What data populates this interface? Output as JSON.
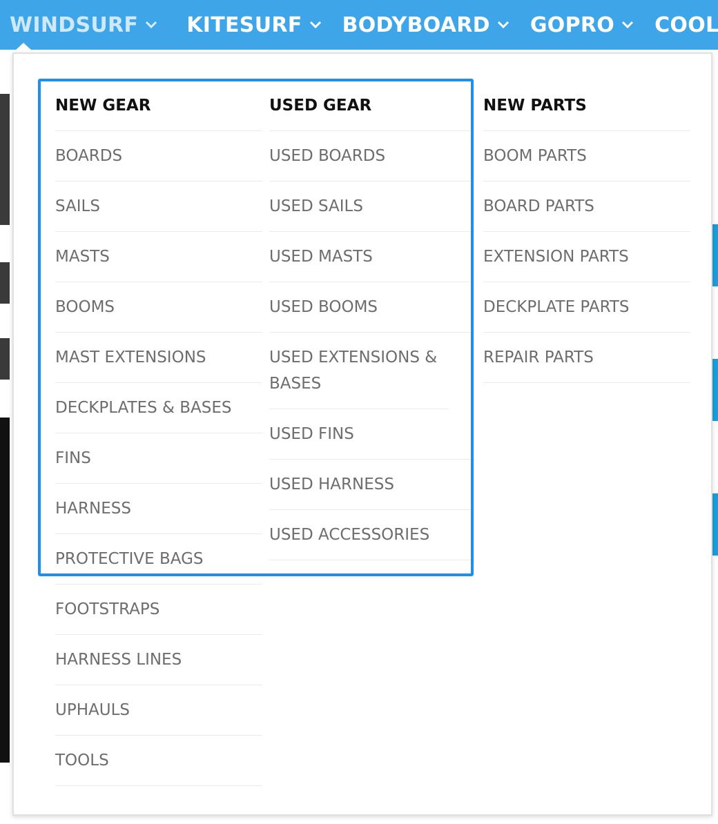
{
  "nav": {
    "items": [
      {
        "label": "WINDSURF",
        "has_chevron": true,
        "active": true
      },
      {
        "label": "KITESURF",
        "has_chevron": true,
        "active": false
      },
      {
        "label": "BODYBOARD",
        "has_chevron": true,
        "active": false
      },
      {
        "label": "GOPRO",
        "has_chevron": true,
        "active": false
      },
      {
        "label": "COOL STU",
        "has_chevron": false,
        "active": false
      }
    ]
  },
  "dropdown": {
    "columns": [
      {
        "heading": "NEW GEAR",
        "links": [
          "BOARDS",
          "SAILS",
          "MASTS",
          "BOOMS",
          "MAST EXTENSIONS",
          "DECKPLATES & BASES",
          "FINS",
          "HARNESS",
          "PROTECTIVE BAGS",
          "FOOTSTRAPS",
          "HARNESS LINES",
          "UPHAULS",
          "TOOLS"
        ]
      },
      {
        "heading": "USED GEAR",
        "links": [
          "USED BOARDS",
          "USED SAILS",
          "USED MASTS",
          "USED BOOMS",
          "USED EXTENSIONS & BASES",
          "USED FINS",
          "USED HARNESS",
          "USED ACCESSORIES"
        ]
      },
      {
        "heading": "NEW PARTS",
        "links": [
          "BOOM PARTS",
          "BOARD PARTS",
          "EXTENSION PARTS",
          "DECKPLATE PARTS",
          "REPAIR PARTS"
        ]
      }
    ]
  },
  "colors": {
    "nav_bg": "#3ea6e8",
    "highlight": "#1e8ff0",
    "link_text": "#6d6d6d",
    "heading_text": "#111111"
  }
}
